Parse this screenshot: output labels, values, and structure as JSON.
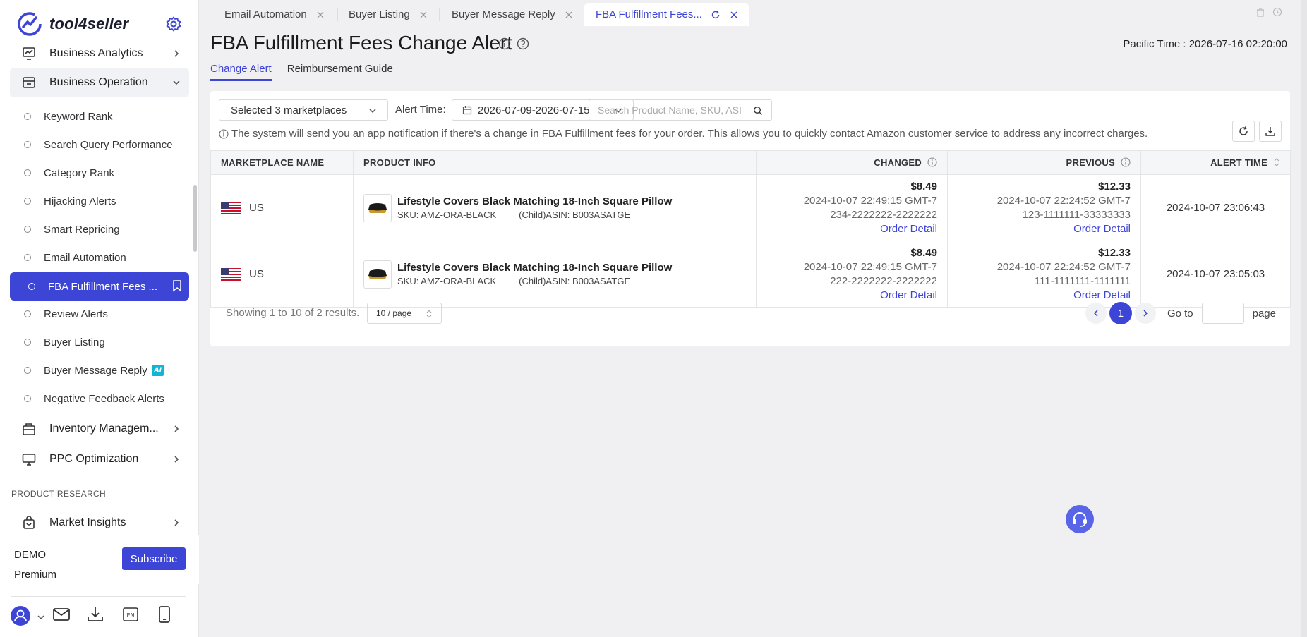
{
  "app": {
    "name": "tool4seller"
  },
  "colors": {
    "accent": "#3d45d6",
    "ai_badge": "#11b6d6"
  },
  "sidebar": {
    "top_items": [
      {
        "label": "Business Analytics",
        "icon": "chart-icon"
      },
      {
        "label": "Business Operation",
        "icon": "store-icon"
      }
    ],
    "sub_items": [
      {
        "label": "Keyword Rank"
      },
      {
        "label": "Search Query Performance"
      },
      {
        "label": "Category Rank"
      },
      {
        "label": "Hijacking Alerts"
      },
      {
        "label": "Smart Repricing"
      },
      {
        "label": "Email Automation"
      },
      {
        "label": "FBA Fulfillment Fees ..."
      },
      {
        "label": "Review Alerts"
      },
      {
        "label": "Buyer Listing"
      },
      {
        "label": "Buyer Message Reply",
        "badge": "AI"
      },
      {
        "label": "Negative Feedback Alerts"
      }
    ],
    "more_items": [
      {
        "label": "Inventory Managem...",
        "icon": "box-icon"
      },
      {
        "label": "PPC Optimization",
        "icon": "monitor-icon"
      }
    ],
    "section_label": "PRODUCT RESEARCH",
    "research_items": [
      {
        "label": "Market Insights",
        "icon": "bag-icon"
      }
    ],
    "account": {
      "name": "DEMO",
      "plan": "Premium",
      "subscribe_label": "Subscribe"
    }
  },
  "tabs": [
    {
      "label": "Email Automation"
    },
    {
      "label": "Buyer Listing"
    },
    {
      "label": "Buyer Message Reply"
    },
    {
      "label": "FBA Fulfillment Fees..."
    }
  ],
  "page": {
    "title": "FBA Fulfillment Fees Change Alert",
    "pacific_time": "Pacific Time : 2026-07-16 02:20:00",
    "subtabs": [
      {
        "label": "Change Alert"
      },
      {
        "label": "Reimbursement Guide"
      }
    ]
  },
  "filters": {
    "marketplaces": "Selected 3 marketplaces",
    "alert_time_label": "Alert Time:",
    "date_range": "2026-07-09-2026-07-15",
    "search_placeholder": "Search Product Name, SKU, ASI"
  },
  "notice": "The system will send you an app notification if there's a change in FBA Fulfillment fees for your order. This allows you to quickly contact Amazon customer service to address any incorrect charges.",
  "table": {
    "headers": {
      "marketplace": "MARKETPLACE NAME",
      "product": "PRODUCT INFO",
      "changed": "CHANGED",
      "previous": "PREVIOUS",
      "alert_time": "ALERT TIME"
    },
    "rows": [
      {
        "marketplace": "US",
        "title": "Lifestyle Covers Black Matching 18-Inch Square Pillow",
        "sku": "SKU: AMZ-ORA-BLACK",
        "asin": "(Child)ASIN: B003ASATGE",
        "changed": {
          "price": "$8.49",
          "time": "2024-10-07 22:49:15 GMT-7",
          "order": "234-2222222-2222222",
          "link": "Order Detail"
        },
        "previous": {
          "price": "$12.33",
          "time": "2024-10-07 22:24:52 GMT-7",
          "order": "123-1111111-33333333",
          "link": "Order Detail"
        },
        "alert_time": "2024-10-07 23:06:43"
      },
      {
        "marketplace": "US",
        "title": "Lifestyle Covers Black Matching 18-Inch Square Pillow",
        "sku": "SKU: AMZ-ORA-BLACK",
        "asin": "(Child)ASIN: B003ASATGE",
        "changed": {
          "price": "$8.49",
          "time": "2024-10-07 22:49:15 GMT-7",
          "order": "222-2222222-2222222",
          "link": "Order Detail"
        },
        "previous": {
          "price": "$12.33",
          "time": "2024-10-07 22:24:52 GMT-7",
          "order": "111-1111111-1111111",
          "link": "Order Detail"
        },
        "alert_time": "2024-10-07 23:05:03"
      }
    ]
  },
  "pagination": {
    "showing": "Showing 1 to 10 of 2 results.",
    "per_page": "10 / page",
    "current": "1",
    "goto_label": "Go to",
    "page_label": "page"
  }
}
